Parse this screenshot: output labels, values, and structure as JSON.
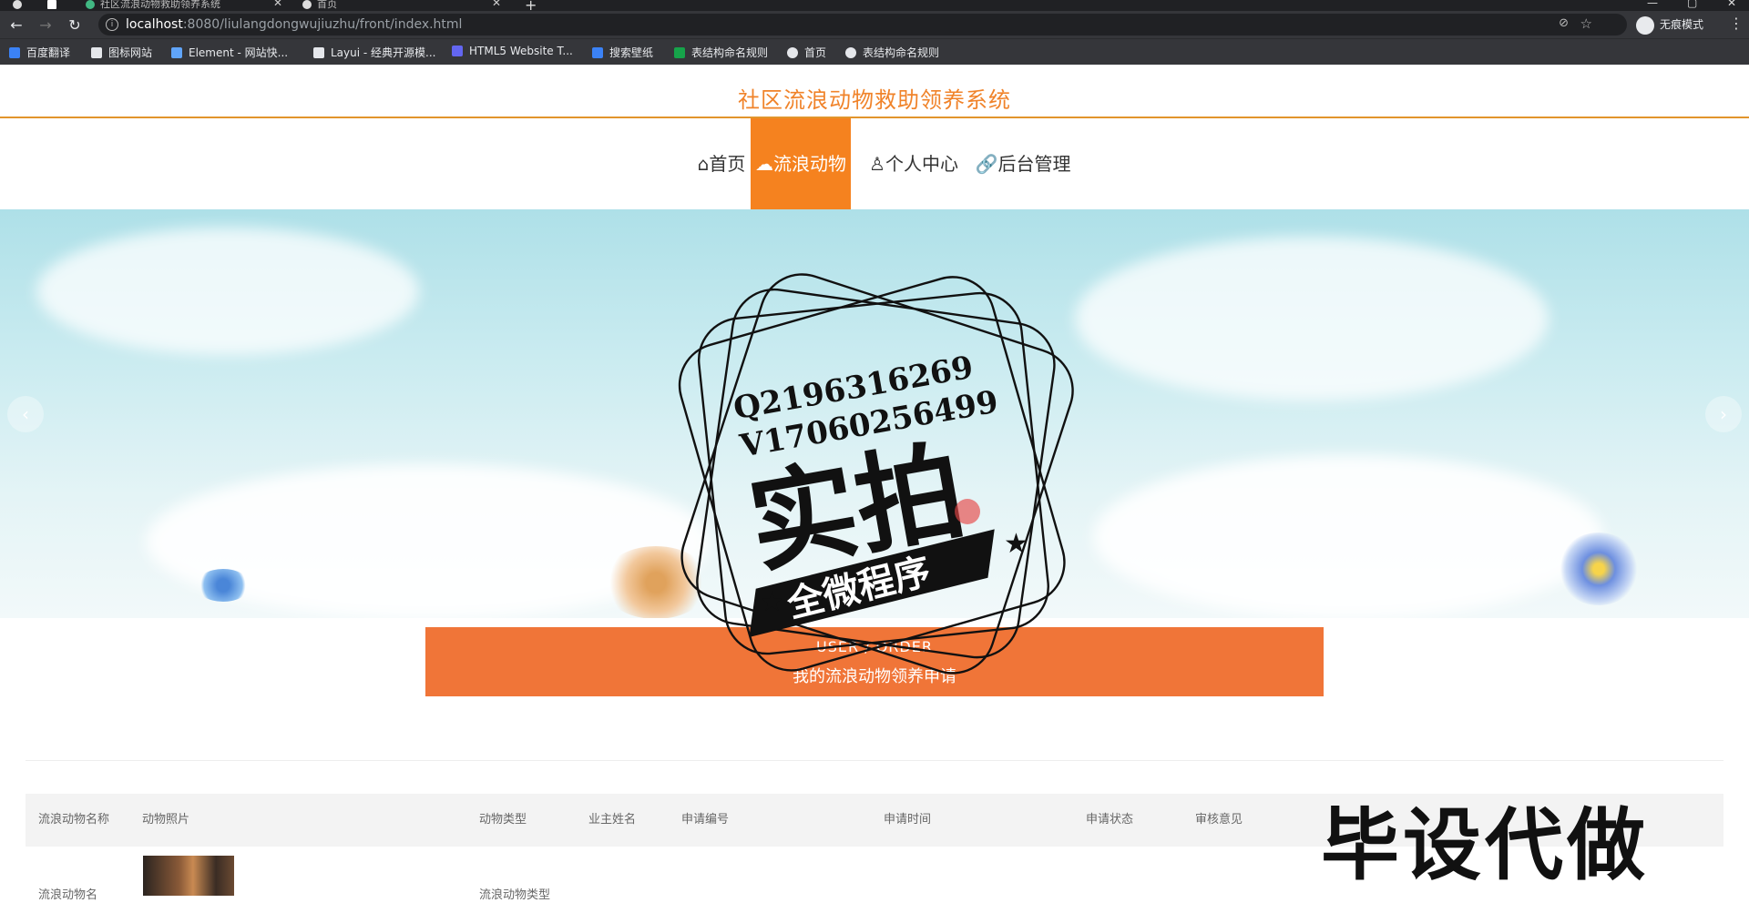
{
  "browser": {
    "tabs": [
      {
        "title": "社区流浪动物救助领养系统"
      },
      {
        "title": "首页"
      }
    ],
    "url_host": "localhost",
    "url_path": ":8080/liulangdongwujiuzhu/front/index.html",
    "incognito_label": "无痕模式",
    "bookmarks": [
      {
        "label": "百度翻译",
        "color": "#3b82f6"
      },
      {
        "label": "图标网站",
        "color": "#e5e7eb"
      },
      {
        "label": "Element - 网站快...",
        "color": "#60a5fa"
      },
      {
        "label": "Layui - 经典开源模...",
        "color": "#e5e7eb"
      },
      {
        "label": "HTML5 Website T...",
        "color": "#6366f1"
      },
      {
        "label": "搜索壁纸",
        "color": "#3b82f6"
      },
      {
        "label": "表结构命名规则",
        "color": "#16a34a"
      },
      {
        "label": "首页",
        "color": "#e5e7eb"
      },
      {
        "label": "表结构命名规则",
        "color": "#e5e7eb"
      }
    ]
  },
  "site": {
    "title": "社区流浪动物救助领养系统",
    "nav": [
      {
        "label": "⌂首页",
        "active": false
      },
      {
        "label": "☁流浪动物",
        "active": true
      },
      {
        "label": "♙个人中心",
        "active": false
      },
      {
        "label": "🔗后台管理",
        "active": false
      }
    ]
  },
  "order_section": {
    "en": "USER / ORDER",
    "cn": "我的流浪动物领养申请"
  },
  "table": {
    "headers": [
      "流浪动物名称",
      "动物照片",
      "动物类型",
      "业主姓名",
      "申请编号",
      "申请时间",
      "申请状态",
      "审核意见"
    ],
    "rows": [
      {
        "name": "流浪动物名",
        "type": "流浪动物类型"
      }
    ]
  },
  "watermark": {
    "line1": "Q2196316269",
    "line2": "V17060256499",
    "big": "实拍",
    "ribbon": "全微程序",
    "corner": "毕设代做"
  },
  "colors": {
    "accent": "#f5821f",
    "order_bar": "#f07538",
    "title": "#f0832a"
  }
}
